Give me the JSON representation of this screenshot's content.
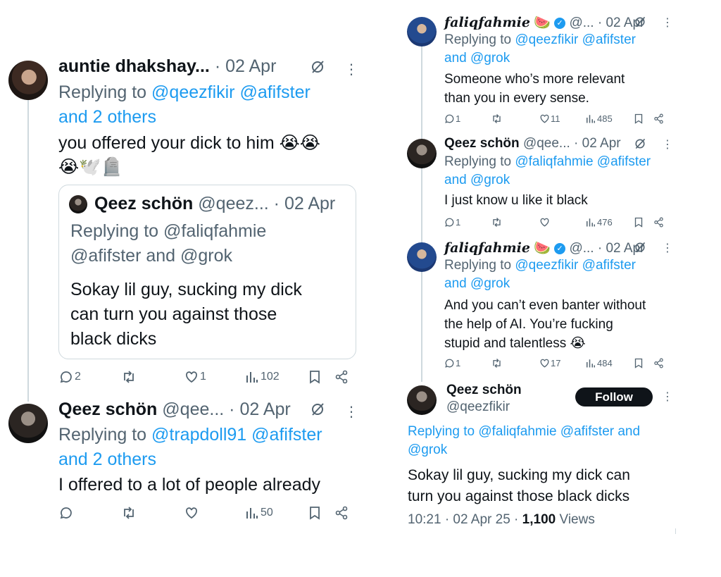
{
  "left": {
    "tweet1": {
      "name": "auntie dhakshay...",
      "date": "· 02 Apr",
      "replying_prefix": "Replying to",
      "replying_handles": "@qeezfikir @afifster",
      "replying_more": "and 2 others",
      "text_line1": "you offered your dick to him 😭😭",
      "text_line2": "😭🕊️🪦",
      "quote": {
        "name": "Qeez schön",
        "handle": "@qeez...",
        "date": "· 02 Apr",
        "replying_line1": "Replying to @faliqfahmie",
        "replying_line2": "@afifster and @grok",
        "text_line1": "Sokay lil guy, sucking my dick",
        "text_line2": "can turn you against those",
        "text_line3": "black dicks"
      },
      "replies": "2",
      "likes": "1",
      "views": "102"
    },
    "tweet2": {
      "name": "Qeez schön",
      "handle": "@qee...",
      "date": "· 02 Apr",
      "replying_prefix": "Replying to",
      "replying_handles": "@trapdoll91 @afifster",
      "replying_more": "and 2 others",
      "text": "I offered to a lot of people already",
      "views": "50"
    }
  },
  "right": {
    "tweet1": {
      "name": "faliqfahmie",
      "emoji": "🍉",
      "handle": "@...",
      "date": "· 02 Apr",
      "replying_prefix": "Replying to",
      "replying_handles": "@qeezfikir @afifster",
      "replying_line2": "and @grok",
      "text_line1": "Someone who’s more relevant",
      "text_line2": "than you in every sense.",
      "replies": "1",
      "likes": "11",
      "views": "485"
    },
    "tweet2": {
      "name": "Qeez schön",
      "handle": "@qee...",
      "date": "· 02 Apr",
      "replying_prefix": "Replying to",
      "replying_handles": "@faliqfahmie @afifster",
      "replying_line2": "and @grok",
      "text": "I just know u like it black",
      "replies": "1",
      "views": "476"
    },
    "tweet3": {
      "name": "faliqfahmie",
      "emoji": "🍉",
      "handle": "@...",
      "date": "· 02 Apr",
      "replying_prefix": "Replying to",
      "replying_handles": "@qeezfikir @afifster",
      "replying_line2": "and @grok",
      "text_line1": "And you can’t even banter without",
      "text_line2": "the help of AI. You’re fucking",
      "text_line3": "stupid and talentless 😭",
      "replies": "1",
      "likes": "17",
      "views": "484"
    },
    "main": {
      "name": "Qeez schön",
      "handle": "@qeezfikir",
      "follow_label": "Follow",
      "replying_line1": "Replying to @faliqfahmie @afifster and",
      "replying_line2": "@grok",
      "text_line1": "Sokay lil guy, sucking my dick can",
      "text_line2": "turn you against those black dicks",
      "timestamp": "10:21 · 02 Apr 25 ·",
      "views_count": "1,100",
      "views_label": "Views"
    }
  },
  "colors": {
    "link": "#1d9bf0",
    "muted": "#536471",
    "text": "#0f1419",
    "border": "#cfd9de"
  },
  "icons": [
    "reply-icon",
    "retweet-icon",
    "like-icon",
    "views-icon",
    "bookmark-icon",
    "share-icon",
    "grok-icon",
    "more-icon",
    "verified-icon"
  ]
}
